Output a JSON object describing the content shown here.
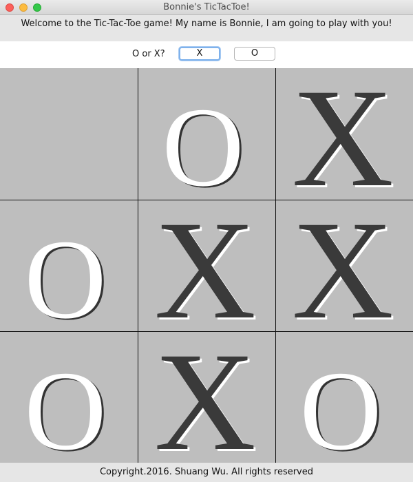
{
  "window": {
    "title": "Bonnie's TicTacToe!"
  },
  "welcome": {
    "message": "Welcome to the Tic-Tac-Toe game!  My name is Bonnie, I am going to play with you!"
  },
  "chooser": {
    "label": "O or X?",
    "x_label": "X",
    "o_label": "O"
  },
  "board": {
    "cells": [
      "",
      "O",
      "X",
      "O",
      "X",
      "X",
      "O",
      "X",
      "O"
    ]
  },
  "footer": {
    "copyright": "Copyright.2016. Shuang Wu. All rights reserved"
  },
  "colors": {
    "board_bg": "#bebebe",
    "x_fill": "#3a3a3a",
    "o_fill": "#ffffff",
    "shadow_light": "#ffffff",
    "shadow_dark": "#333333"
  }
}
